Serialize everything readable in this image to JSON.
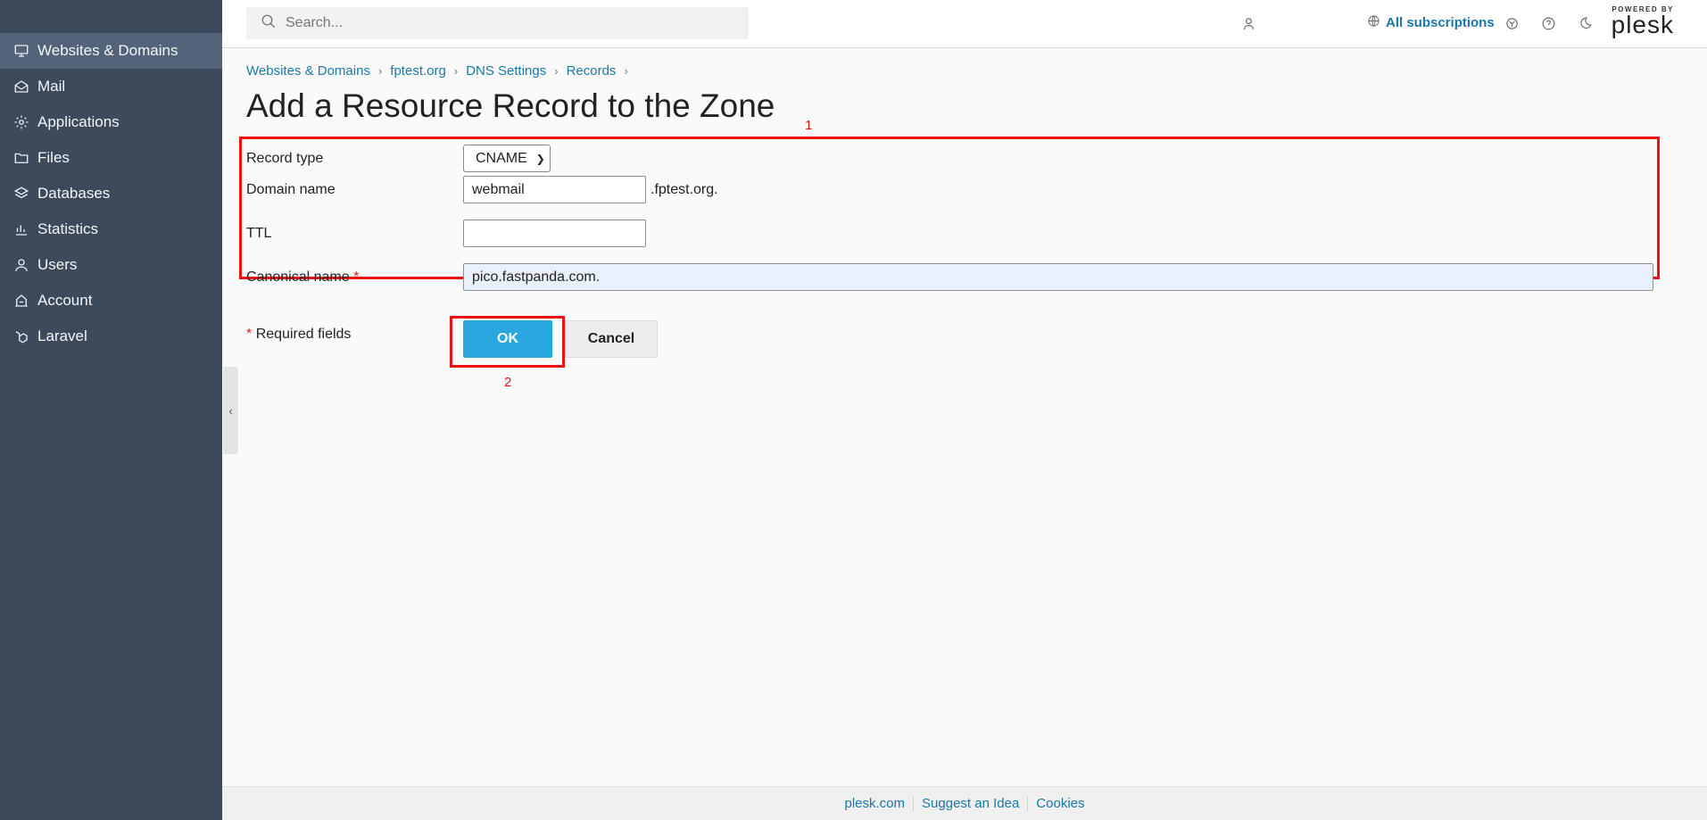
{
  "sidebar": {
    "items": [
      {
        "label": "Websites & Domains",
        "icon": "monitor-icon",
        "active": true
      },
      {
        "label": "Mail",
        "icon": "mail-icon"
      },
      {
        "label": "Applications",
        "icon": "gear-icon"
      },
      {
        "label": "Files",
        "icon": "folder-icon"
      },
      {
        "label": "Databases",
        "icon": "layers-icon"
      },
      {
        "label": "Statistics",
        "icon": "bar-chart-icon"
      },
      {
        "label": "Users",
        "icon": "user-icon"
      },
      {
        "label": "Account",
        "icon": "account-icon"
      },
      {
        "label": "Laravel",
        "icon": "laravel-icon"
      }
    ]
  },
  "header": {
    "search_placeholder": "Search...",
    "subscriptions_label": "All subscriptions",
    "logo_powered": "POWERED BY",
    "logo_word": "plesk"
  },
  "breadcrumb": [
    "Websites & Domains",
    "fptest.org",
    "DNS Settings",
    "Records"
  ],
  "page_title": "Add a Resource Record to the Zone",
  "form": {
    "record_type_label": "Record type",
    "record_type_value": "CNAME",
    "domain_name_label": "Domain name",
    "domain_name_value": "webmail",
    "domain_suffix": ".fptest.org.",
    "ttl_label": "TTL",
    "ttl_value": "",
    "canonical_label": "Canonical name",
    "canonical_value": "pico.fastpanda.com.",
    "required_marker": "*",
    "required_note": "Required fields"
  },
  "buttons": {
    "ok": "OK",
    "cancel": "Cancel"
  },
  "annotations": {
    "box1": "1",
    "box2": "2"
  },
  "footer": [
    "plesk.com",
    "Suggest an Idea",
    "Cookies"
  ],
  "colors": {
    "sidebar_bg": "#3c4a5b",
    "accent": "#28a8df",
    "link": "#1a78a8",
    "annotation": "#ee1111"
  }
}
